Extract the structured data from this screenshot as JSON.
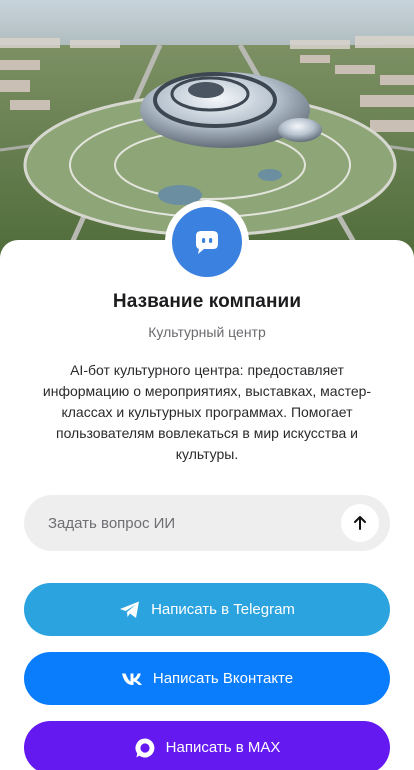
{
  "company": {
    "name": "Название компании",
    "category": "Культурный центр",
    "description": "AI-бот культурного центра: предоставляет информацию о мероприятиях, выставках, мастер-классах и культурных программах. Помогает пользователям вовлекаться в мир искусства и культуры.",
    "avatar_icon": "chat-bubble-icon"
  },
  "ask": {
    "placeholder": "Задать вопрос ИИ",
    "value": "",
    "send_icon": "arrow-up-icon"
  },
  "buttons": {
    "telegram": {
      "label": "Написать в Telegram",
      "icon": "telegram-icon",
      "color": "#2aa3df"
    },
    "vk": {
      "label": "Написать Вконтакте",
      "icon": "vk-icon",
      "color": "#0a7dfc"
    },
    "max": {
      "label": "Написать в MAX",
      "icon": "max-icon",
      "color": "#6419f0"
    }
  },
  "colors": {
    "accent": "#3b82e0",
    "input_bg": "#eeeeef"
  }
}
